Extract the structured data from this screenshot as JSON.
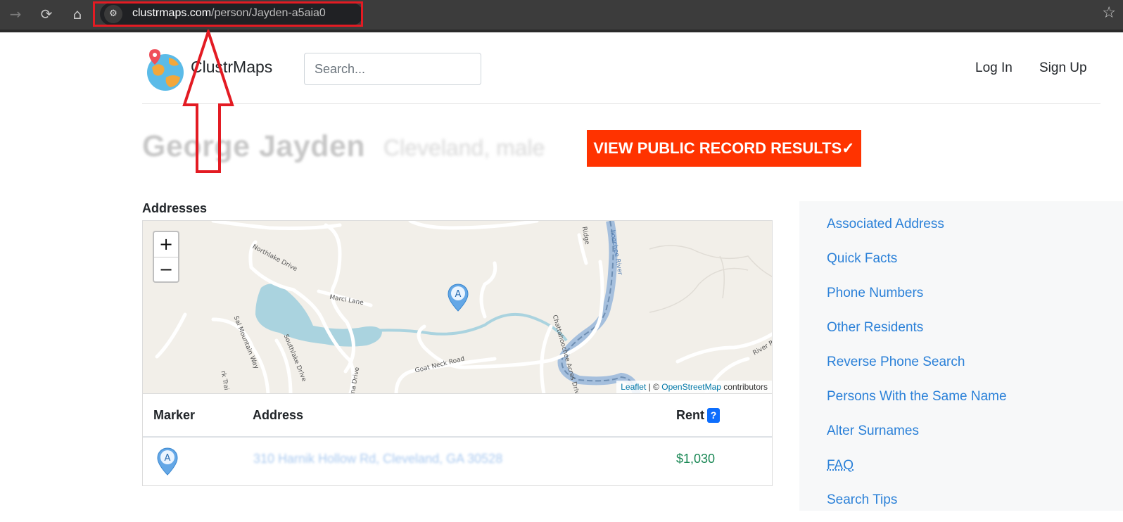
{
  "browser": {
    "back_icon": "arrow-right-icon",
    "reload_icon": "reload-icon",
    "home_icon": "home-icon",
    "url_domain": "clustrmaps.com",
    "url_path": "/person/Jayden-a5aia0",
    "bookmark_icon": "star-icon"
  },
  "site": {
    "brand": "ClustrMaps",
    "search_placeholder": "Search...",
    "login": "Log In",
    "signup": "Sign Up"
  },
  "profile": {
    "name": "George Jayden",
    "meta": "Cleveland, male",
    "cta": "VIEW PUBLIC RECORD RESULTS✓"
  },
  "addresses": {
    "heading": "Addresses",
    "map": {
      "zoom_in": "+",
      "zoom_out": "−",
      "marker_letter": "A",
      "labels": {
        "northlake": "Northlake Drive",
        "marci": "Marci Lane",
        "sal_mountain": "Sal Mountain Way",
        "southlake": "Southlake Drive",
        "goat_neck": "Goat Neck Road",
        "chattahoochee_acres": "Chattahoochee Acres Drive",
        "chattahoochee_river": "hoochee River",
        "ridge": "Ridge",
        "river": "River R",
        "park": "rk Trai",
        "ama": "ama Drive"
      },
      "attribution_leaflet": "Leaflet",
      "attribution_sep": " | © ",
      "attribution_osm": "OpenStreetMap",
      "attribution_tail": " contributors"
    },
    "table": {
      "headers": {
        "marker": "Marker",
        "address": "Address",
        "rent": "Rent",
        "rent_help": "?"
      },
      "rows": [
        {
          "marker": "A",
          "address": "310 Harnik Hollow Rd, Cleveland, GA 30528",
          "rent": "$1,030"
        }
      ]
    }
  },
  "sidebar": {
    "items": [
      "Associated Address",
      "Quick Facts",
      "Phone Numbers",
      "Other Residents",
      "Reverse Phone Search",
      "Persons With the Same Name",
      "Alter Surnames",
      "FAQ",
      "Search Tips"
    ]
  },
  "colors": {
    "cta_bg": "#ff3300",
    "annotation_red": "#e31b23",
    "link_blue": "#2a80d8",
    "rent_green": "#198754"
  }
}
